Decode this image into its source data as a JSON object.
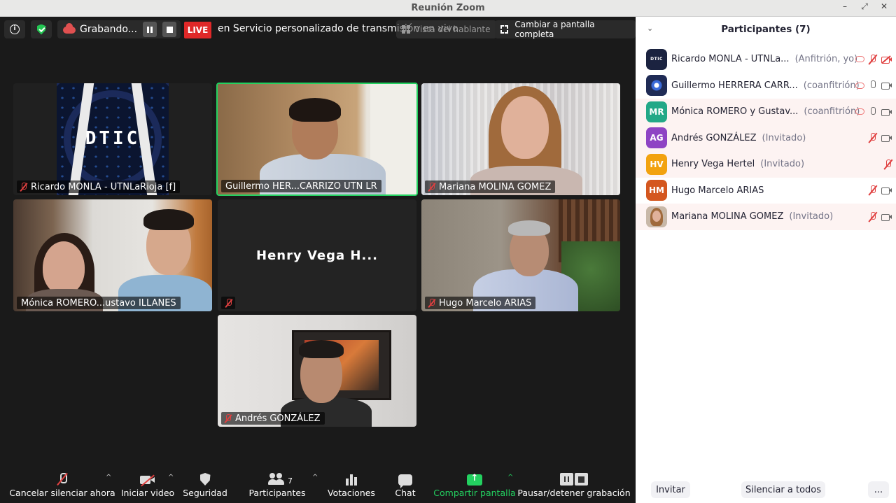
{
  "window": {
    "title": "Reunión Zoom",
    "controls": [
      "–",
      "⤢",
      "✕"
    ]
  },
  "topbar": {
    "recording_label": "Grabando...",
    "live_label": "LIVE",
    "stream_text": "en Servicio personalizado de transmisión en vivo",
    "speaker_view_label": "Vista del hablante",
    "fullscreen_label": "Cambiar a pantalla completa"
  },
  "tiles": {
    "ricardo": {
      "name": "Ricardo MONLA - UTNLaRioja [f]",
      "logo_text": "DTIC"
    },
    "guillermo": {
      "name": "Guillermo HER...CARRIZO UTN LR"
    },
    "mariana": {
      "name": "Mariana MOLINA GOMEZ"
    },
    "monica": {
      "name": "Mónica ROMERO...ustavo ILLANES"
    },
    "henry": {
      "name": "Henry Vega H..."
    },
    "hugo": {
      "name": "Hugo Marcelo ARIAS"
    },
    "andres": {
      "name": "Andrés GONZÁLEZ"
    }
  },
  "toolbar": {
    "mute": "Cancelar silenciar ahora",
    "video": "Iniciar video",
    "security": "Seguridad",
    "participants": "Participantes",
    "participants_count": "7",
    "polls": "Votaciones",
    "chat": "Chat",
    "share": "Compartir pantalla",
    "record": "Pausar/detener grabación",
    "accent_green": "#23d160"
  },
  "panel": {
    "title": "Participantes (7)",
    "participants": [
      {
        "name": "Ricardo MONLA - UTNLa...",
        "role": "(Anfitrión, yo)",
        "avatar_text": "DTIC",
        "avatar_color": "#1b2340"
      },
      {
        "name": "Guillermo HERRERA CARR...",
        "role": "(coanfitrión)",
        "avatar_text": "",
        "avatar_color": "#1f2b55"
      },
      {
        "name": "Mónica ROMERO y Gustav...",
        "role": "(coanfitrión)",
        "avatar_text": "MR",
        "avatar_color": "#23a887"
      },
      {
        "name": "Andrés GONZÁLEZ",
        "role": "(Invitado)",
        "avatar_text": "AG",
        "avatar_color": "#8e44c4"
      },
      {
        "name": "Henry Vega Hertel",
        "role": "(Invitado)",
        "avatar_text": "HV",
        "avatar_color": "#f2a20f"
      },
      {
        "name": "Hugo Marcelo ARIAS",
        "role": "",
        "avatar_text": "HM",
        "avatar_color": "#d4571f"
      },
      {
        "name": "Mariana MOLINA GOMEZ",
        "role": "(Invitado)",
        "avatar_text": "",
        "avatar_color": "#c8b8a8"
      }
    ],
    "invite_label": "Invitar",
    "mute_all_label": "Silenciar a todos",
    "more_label": "..."
  }
}
